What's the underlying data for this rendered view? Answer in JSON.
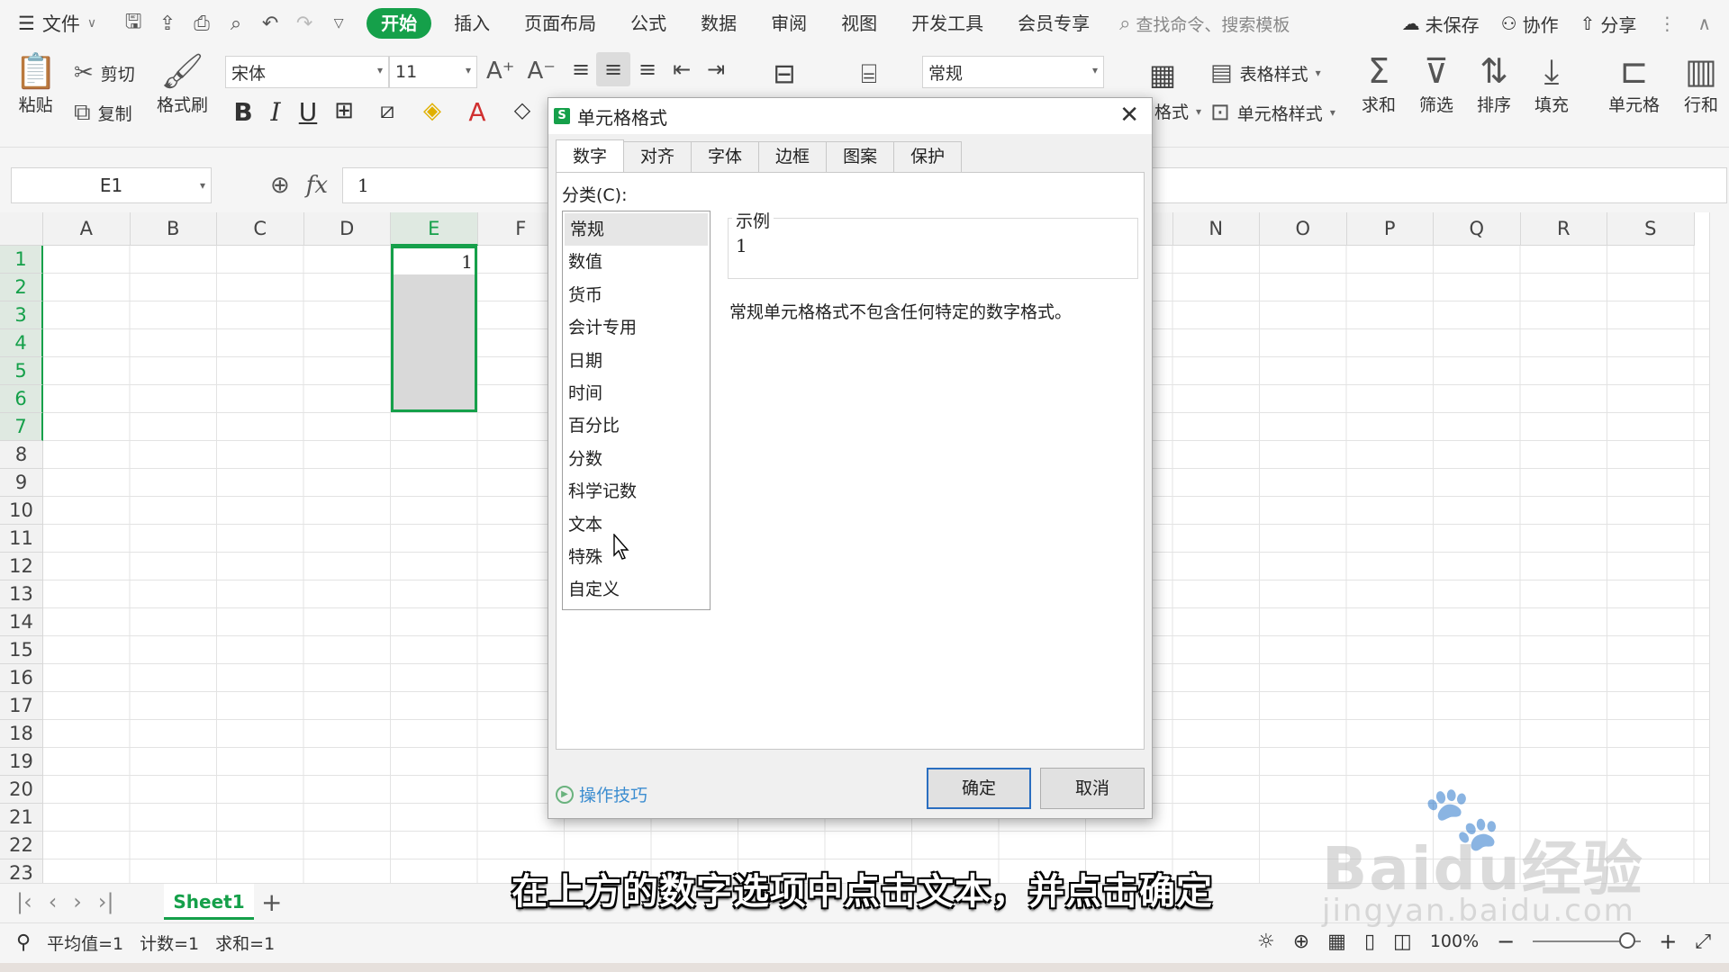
{
  "menubar": {
    "file_label": "文件",
    "tabs": [
      "开始",
      "插入",
      "页面布局",
      "公式",
      "数据",
      "审阅",
      "视图",
      "开发工具",
      "会员专享"
    ],
    "active_tab": "开始",
    "search_placeholder": "查找命令、搜索模板",
    "unsaved_label": "未保存",
    "collab_label": "协作",
    "share_label": "分享"
  },
  "ribbon": {
    "paste_label": "粘贴",
    "cut_label": "剪切",
    "copy_label": "复制",
    "format_painter_label": "格式刷",
    "font_name": "宋体",
    "font_size": "11",
    "number_format": "常规",
    "table_style_label": "表格样式",
    "cond_format_label": "格式",
    "cell_style_label": "单元格样式",
    "sum_label": "求和",
    "filter_label": "筛选",
    "sort_label": "排序",
    "fill_label": "填充",
    "cell_label": "单元格",
    "rowcol_label": "行和"
  },
  "formula_bar": {
    "name_box": "E1",
    "fx_symbol": "fx",
    "value": "1"
  },
  "sheet": {
    "columns": [
      "A",
      "B",
      "C",
      "D",
      "E",
      "F",
      "",
      "",
      "",
      "",
      "",
      "",
      "",
      "N",
      "O",
      "P",
      "Q",
      "R",
      "S"
    ],
    "rows": [
      "1",
      "2",
      "3",
      "4",
      "5",
      "6",
      "7",
      "8",
      "9",
      "10",
      "11",
      "12",
      "13",
      "14",
      "15",
      "16",
      "17",
      "18",
      "19",
      "20",
      "21",
      "22",
      "23"
    ],
    "selected_column": "E",
    "cell_E1": "1",
    "tab_name": "Sheet1"
  },
  "statusbar": {
    "average": "平均值=1",
    "count": "计数=1",
    "sum": "求和=1",
    "zoom": "100%"
  },
  "dialog": {
    "title": "单元格格式",
    "tabs": [
      "数字",
      "对齐",
      "字体",
      "边框",
      "图案",
      "保护"
    ],
    "active_tab": "数字",
    "category_label": "分类(C):",
    "categories": [
      "常规",
      "数值",
      "货币",
      "会计专用",
      "日期",
      "时间",
      "百分比",
      "分数",
      "科学记数",
      "文本",
      "特殊",
      "自定义"
    ],
    "selected_category": "常规",
    "sample_label": "示例",
    "sample_value": "1",
    "description": "常规单元格格式不包含任何特定的数字格式。",
    "tips_label": "操作技巧",
    "ok_label": "确定",
    "cancel_label": "取消"
  },
  "caption": "在上方的数字选项中点击文本，并点击确定",
  "watermark": {
    "brand": "Baidu经验",
    "url": "jingyan.baidu.com"
  },
  "colors": {
    "accent": "#15a04a",
    "dialog_button_border": "#2a6ec0",
    "link": "#3c8dd0"
  }
}
